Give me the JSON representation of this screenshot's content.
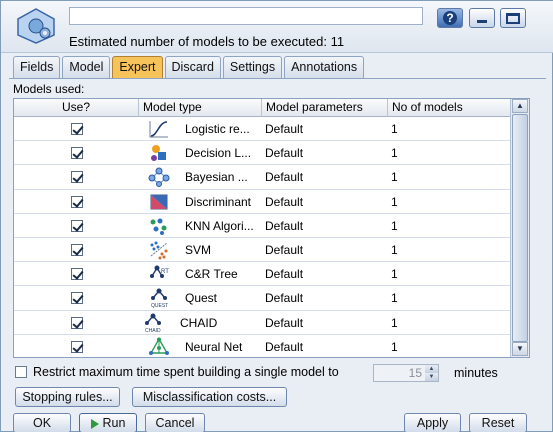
{
  "window": {
    "summary": "Estimated number of models to be executed: 11"
  },
  "tabs": [
    {
      "label": "Fields"
    },
    {
      "label": "Model"
    },
    {
      "label": "Expert"
    },
    {
      "label": "Discard"
    },
    {
      "label": "Settings"
    },
    {
      "label": "Annotations"
    }
  ],
  "active_tab": "Expert",
  "models_used_label": "Models used:",
  "table": {
    "headers": [
      "Use?",
      "Model type",
      "Model parameters",
      "No of models"
    ],
    "rows": [
      {
        "use": true,
        "icon": "logistic-icon",
        "name": "Logistic re...",
        "params": "Default",
        "count": "1"
      },
      {
        "use": true,
        "icon": "decision-list-icon",
        "name": "Decision L...",
        "params": "Default",
        "count": "1"
      },
      {
        "use": true,
        "icon": "bayesian-icon",
        "name": "Bayesian ...",
        "params": "Default",
        "count": "1"
      },
      {
        "use": true,
        "icon": "discriminant-icon",
        "name": "Discriminant",
        "params": "Default",
        "count": "1"
      },
      {
        "use": true,
        "icon": "knn-icon",
        "name": "KNN Algori...",
        "params": "Default",
        "count": "1"
      },
      {
        "use": true,
        "icon": "svm-icon",
        "name": "SVM",
        "params": "Default",
        "count": "1"
      },
      {
        "use": true,
        "icon": "crt-icon",
        "name": "C&R Tree",
        "params": "Default",
        "count": "1"
      },
      {
        "use": true,
        "icon": "quest-icon",
        "name": "Quest",
        "params": "Default",
        "count": "1"
      },
      {
        "use": true,
        "icon": "chaid-icon",
        "name": "CHAID",
        "params": "Default",
        "count": "1"
      },
      {
        "use": true,
        "icon": "neural-net-icon",
        "name": "Neural Net",
        "params": "Default",
        "count": "1"
      }
    ]
  },
  "restrict": {
    "checked": false,
    "label": "Restrict maximum time spent building a single model to",
    "value": "15",
    "unit": "minutes"
  },
  "buttons": {
    "stopping_rules": "Stopping rules...",
    "misclassification_costs": "Misclassification costs...",
    "ok": "OK",
    "run": "Run",
    "cancel": "Cancel",
    "apply": "Apply",
    "reset": "Reset"
  },
  "icons": {
    "app": "model-node-icon",
    "help": "help-icon",
    "minimize": "minimize-icon",
    "maximize": "maximize-icon"
  },
  "colors": {
    "active_tab": "#f6c25a",
    "window_bg": "#e9edf4",
    "help_button": "#3f6fb6"
  }
}
